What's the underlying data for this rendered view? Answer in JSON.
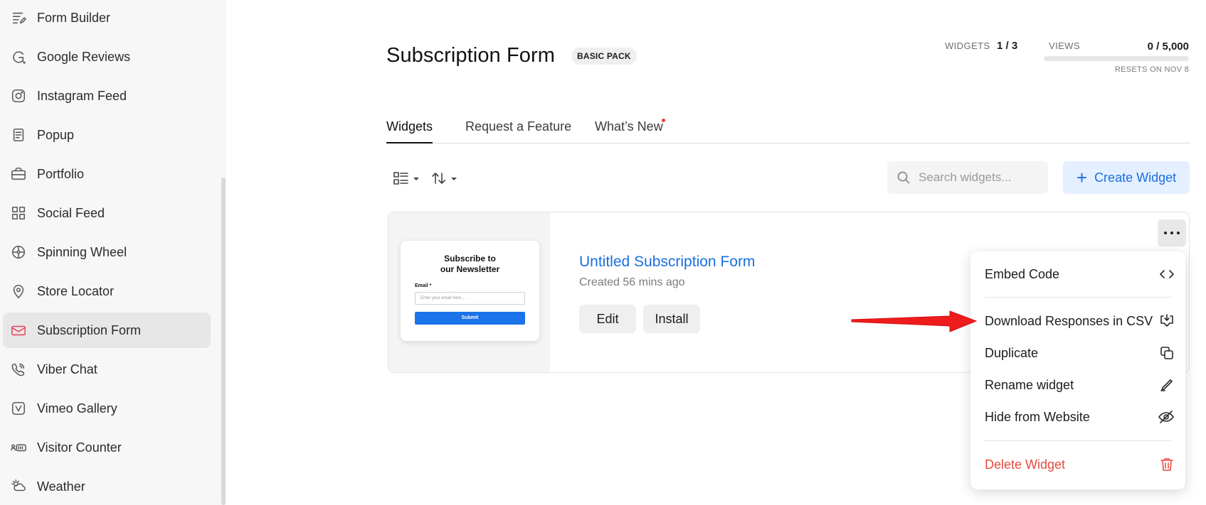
{
  "sidebar": {
    "items": [
      {
        "label": "Form Builder",
        "icon": "form-builder-icon"
      },
      {
        "label": "Google Reviews",
        "icon": "google-reviews-icon"
      },
      {
        "label": "Instagram Feed",
        "icon": "instagram-icon"
      },
      {
        "label": "Popup",
        "icon": "popup-icon"
      },
      {
        "label": "Portfolio",
        "icon": "portfolio-icon"
      },
      {
        "label": "Social Feed",
        "icon": "social-feed-icon"
      },
      {
        "label": "Spinning Wheel",
        "icon": "spinning-wheel-icon"
      },
      {
        "label": "Store Locator",
        "icon": "store-locator-icon"
      },
      {
        "label": "Subscription Form",
        "icon": "subscription-form-icon",
        "active": true
      },
      {
        "label": "Viber Chat",
        "icon": "viber-icon"
      },
      {
        "label": "Vimeo Gallery",
        "icon": "vimeo-icon"
      },
      {
        "label": "Visitor Counter",
        "icon": "visitor-counter-icon"
      },
      {
        "label": "Weather",
        "icon": "weather-icon"
      }
    ]
  },
  "header": {
    "title": "Subscription Form",
    "badge": "BASIC PACK",
    "widgets_label": "WIDGETS",
    "widgets_value": "1 / 3",
    "views_label": "VIEWS",
    "views_value": "0 / 5,000",
    "views_fraction": 0.0,
    "reset_note": "RESETS ON NOV 8"
  },
  "tabs": [
    {
      "label": "Widgets",
      "active": true
    },
    {
      "label": "Request a Feature"
    },
    {
      "label": "What’s New",
      "has_dot": true
    }
  ],
  "toolbar": {
    "search_placeholder": "Search widgets...",
    "create_label": "Create Widget",
    "accent": "#1a6fe0"
  },
  "widget": {
    "name": "Untitled Subscription Form",
    "created": "Created 56 mins ago",
    "edit_label": "Edit",
    "install_label": "Install",
    "preview": {
      "title_line1": "Subscribe to",
      "title_line2": "our Newsletter",
      "email_label": "Email *",
      "email_placeholder": "Enter your email here...",
      "submit_label": "Submit"
    }
  },
  "menu": {
    "items": [
      {
        "label": "Embed Code",
        "icon": "code-icon"
      },
      {
        "label": "Download Responses in CSV",
        "icon": "download-icon"
      },
      {
        "label": "Duplicate",
        "icon": "duplicate-icon"
      },
      {
        "label": "Rename widget",
        "icon": "pencil-icon"
      },
      {
        "label": "Hide from Website",
        "icon": "eye-off-icon"
      },
      {
        "label": "Delete Widget",
        "icon": "trash-icon",
        "danger": true
      }
    ],
    "danger_color": "#e64a3f"
  }
}
